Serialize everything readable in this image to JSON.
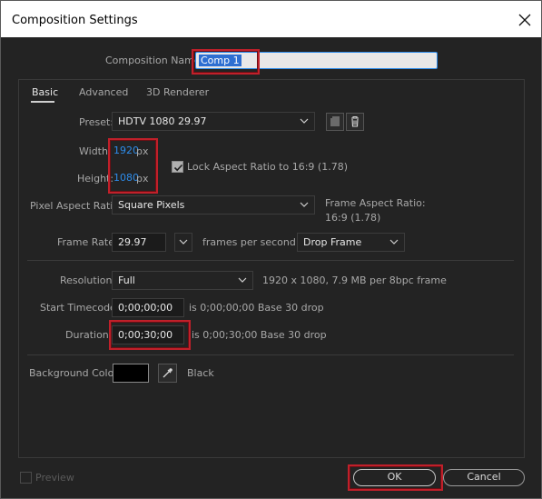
{
  "window": {
    "title": "Composition Settings",
    "close_icon": "close-icon"
  },
  "comp_name": {
    "label": "Composition Name:",
    "value": "Comp 1"
  },
  "tabs": [
    {
      "label": "Basic",
      "active": true
    },
    {
      "label": "Advanced",
      "active": false
    },
    {
      "label": "3D Renderer",
      "active": false
    }
  ],
  "preset": {
    "label": "Preset:",
    "value": "HDTV 1080 29.97"
  },
  "width": {
    "label": "Width:",
    "value": "1920",
    "unit": "px"
  },
  "height": {
    "label": "Height:",
    "value": "1080",
    "unit": "px"
  },
  "lock_aspect": {
    "label": "Lock Aspect Ratio to 16:9 (1.78)",
    "checked": true
  },
  "pixel_aspect": {
    "label": "Pixel Aspect Ratio:",
    "value": "Square Pixels",
    "frame_aspect_label": "Frame Aspect Ratio:",
    "frame_aspect_value": "16:9 (1.78)"
  },
  "frame_rate": {
    "label": "Frame Rate:",
    "value": "29.97",
    "unit": "frames per second",
    "drop_value": "Drop Frame"
  },
  "resolution": {
    "label": "Resolution:",
    "value": "Full",
    "info": "1920 x 1080, 7.9 MB per 8bpc frame"
  },
  "start_timecode": {
    "label": "Start Timecode:",
    "value": "0;00;00;00",
    "info": "is 0;00;00;00  Base 30  drop"
  },
  "duration": {
    "label": "Duration:",
    "value": "0;00;30;00",
    "info": "is 0;00;30;00  Base 30  drop"
  },
  "background": {
    "label": "Background Color:",
    "color": "#000000",
    "name": "Black"
  },
  "footer": {
    "preview_label": "Preview",
    "ok_label": "OK",
    "cancel_label": "Cancel"
  },
  "colors": {
    "highlight": "#c0202a",
    "accent_blue": "#2d8ceb",
    "background": "#232323"
  }
}
